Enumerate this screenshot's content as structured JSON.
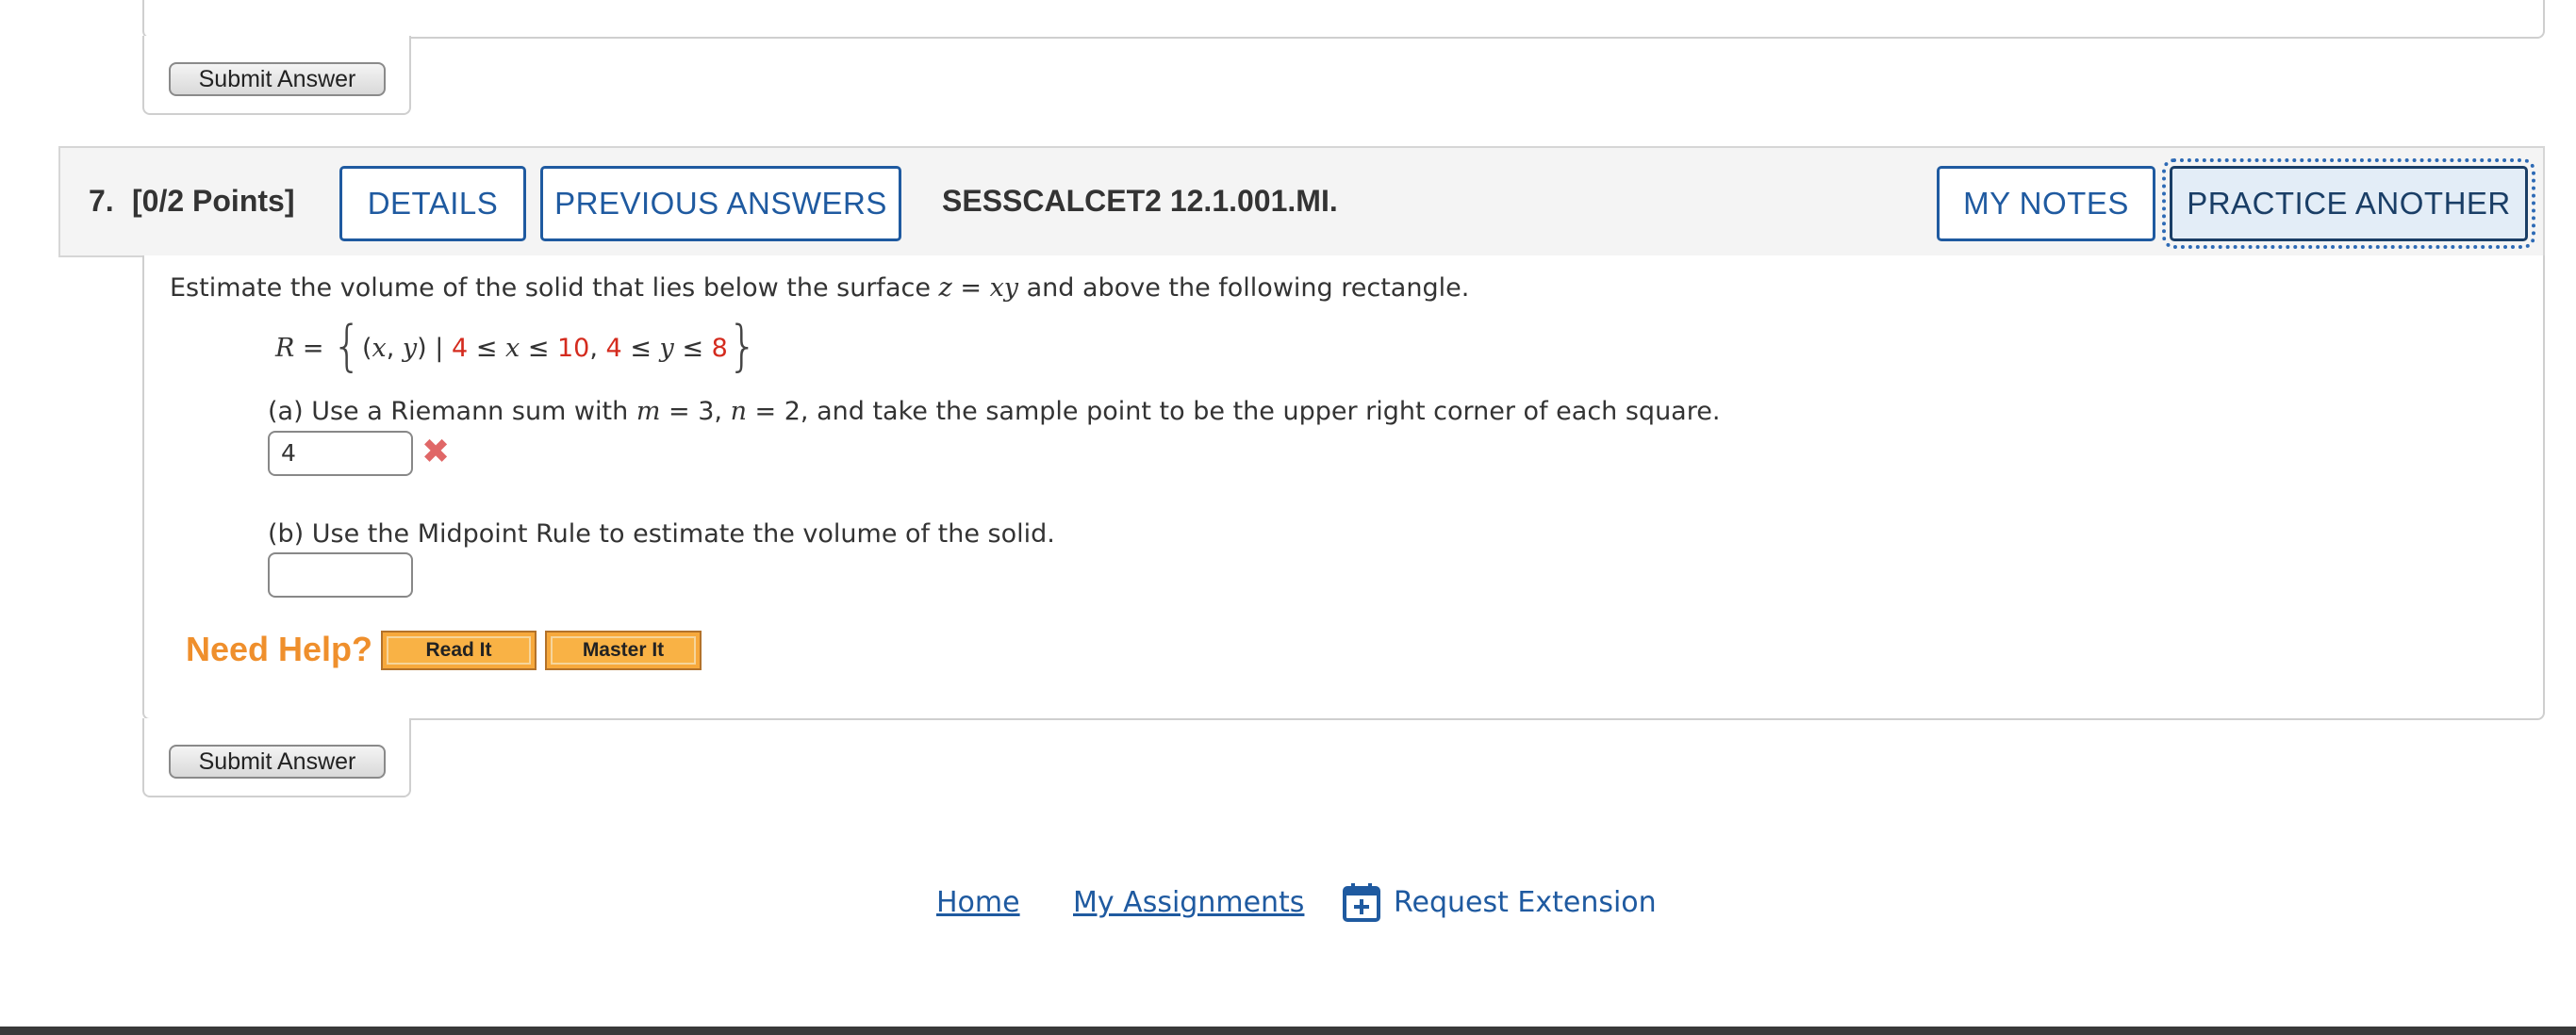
{
  "previous_question": {
    "submit_label": "Submit Answer"
  },
  "question": {
    "number": "7.",
    "points": "[0/2 Points]",
    "details_label": "DETAILS",
    "previous_answers_label": "PREVIOUS ANSWERS",
    "code": "SESSCALCET2 12.1.001.MI.",
    "my_notes_label": "MY NOTES",
    "practice_another_label": "PRACTICE ANOTHER",
    "prompt_prefix": "Estimate the volume of the solid that lies below the surface ",
    "prompt_z": "z",
    "prompt_eq": " = ",
    "prompt_xy": "xy",
    "prompt_suffix": " and above the following rectangle.",
    "region": {
      "name": "R",
      "x_min": "4",
      "x_max": "10",
      "y_min": "4",
      "y_max": "8"
    },
    "part_a": {
      "text_1": "(a) Use a Riemann sum with ",
      "m_var": "m",
      "text_2": " = 3, ",
      "n_var": "n",
      "text_3": " = 2, and take the sample point to be the upper right corner of each square.",
      "answer_value": "4",
      "status_icon": "incorrect-x-icon"
    },
    "part_b": {
      "text": "(b) Use the Midpoint Rule to estimate the volume of the solid.",
      "answer_value": ""
    },
    "need_help_label": "Need Help?",
    "read_it_label": "Read It",
    "master_it_label": "Master It",
    "submit_label": "Submit Answer"
  },
  "footer": {
    "home_label": "Home",
    "my_assignments_label": "My Assignments",
    "request_extension_label": "Request Extension",
    "request_extension_icon": "calendar-plus-icon"
  },
  "colors": {
    "accent_blue": "#1f5aa0",
    "red_value": "#d42b1e",
    "need_help_orange": "#ef8f2c",
    "help_button": "#f7a93c"
  }
}
